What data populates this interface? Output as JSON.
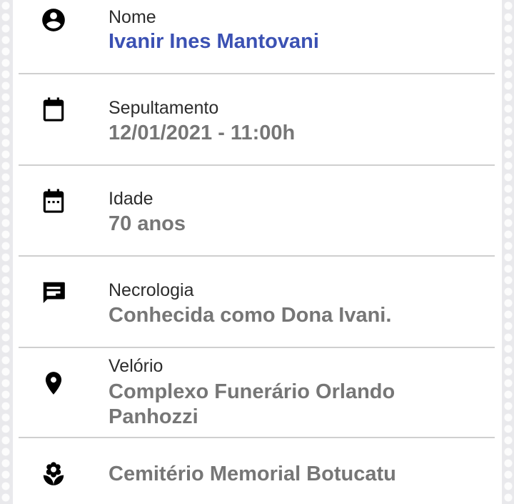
{
  "fields": [
    {
      "icon": "account-circle-icon",
      "label": "Nome",
      "value": "Ivanir Ines Mantovani"
    },
    {
      "icon": "calendar-icon",
      "label": "Sepultamento",
      "value": "12/01/2021 - 11:00h"
    },
    {
      "icon": "calendar-dots-icon",
      "label": "Idade",
      "value": "70 anos"
    },
    {
      "icon": "message-icon",
      "label": "Necrologia",
      "value": "Conhecida como Dona Ivani."
    },
    {
      "icon": "map-pin-icon",
      "label": "Velório",
      "value": "Complexo Funerário Orlando Panhozzi"
    },
    {
      "icon": "flower-icon",
      "label": "",
      "value": "Cemitério Memorial Botucatu"
    }
  ],
  "colors": {
    "name_accent": "#3b51b3",
    "value_text": "#767676",
    "label_text": "#2c2c2c",
    "divider": "#cfcfcf"
  }
}
